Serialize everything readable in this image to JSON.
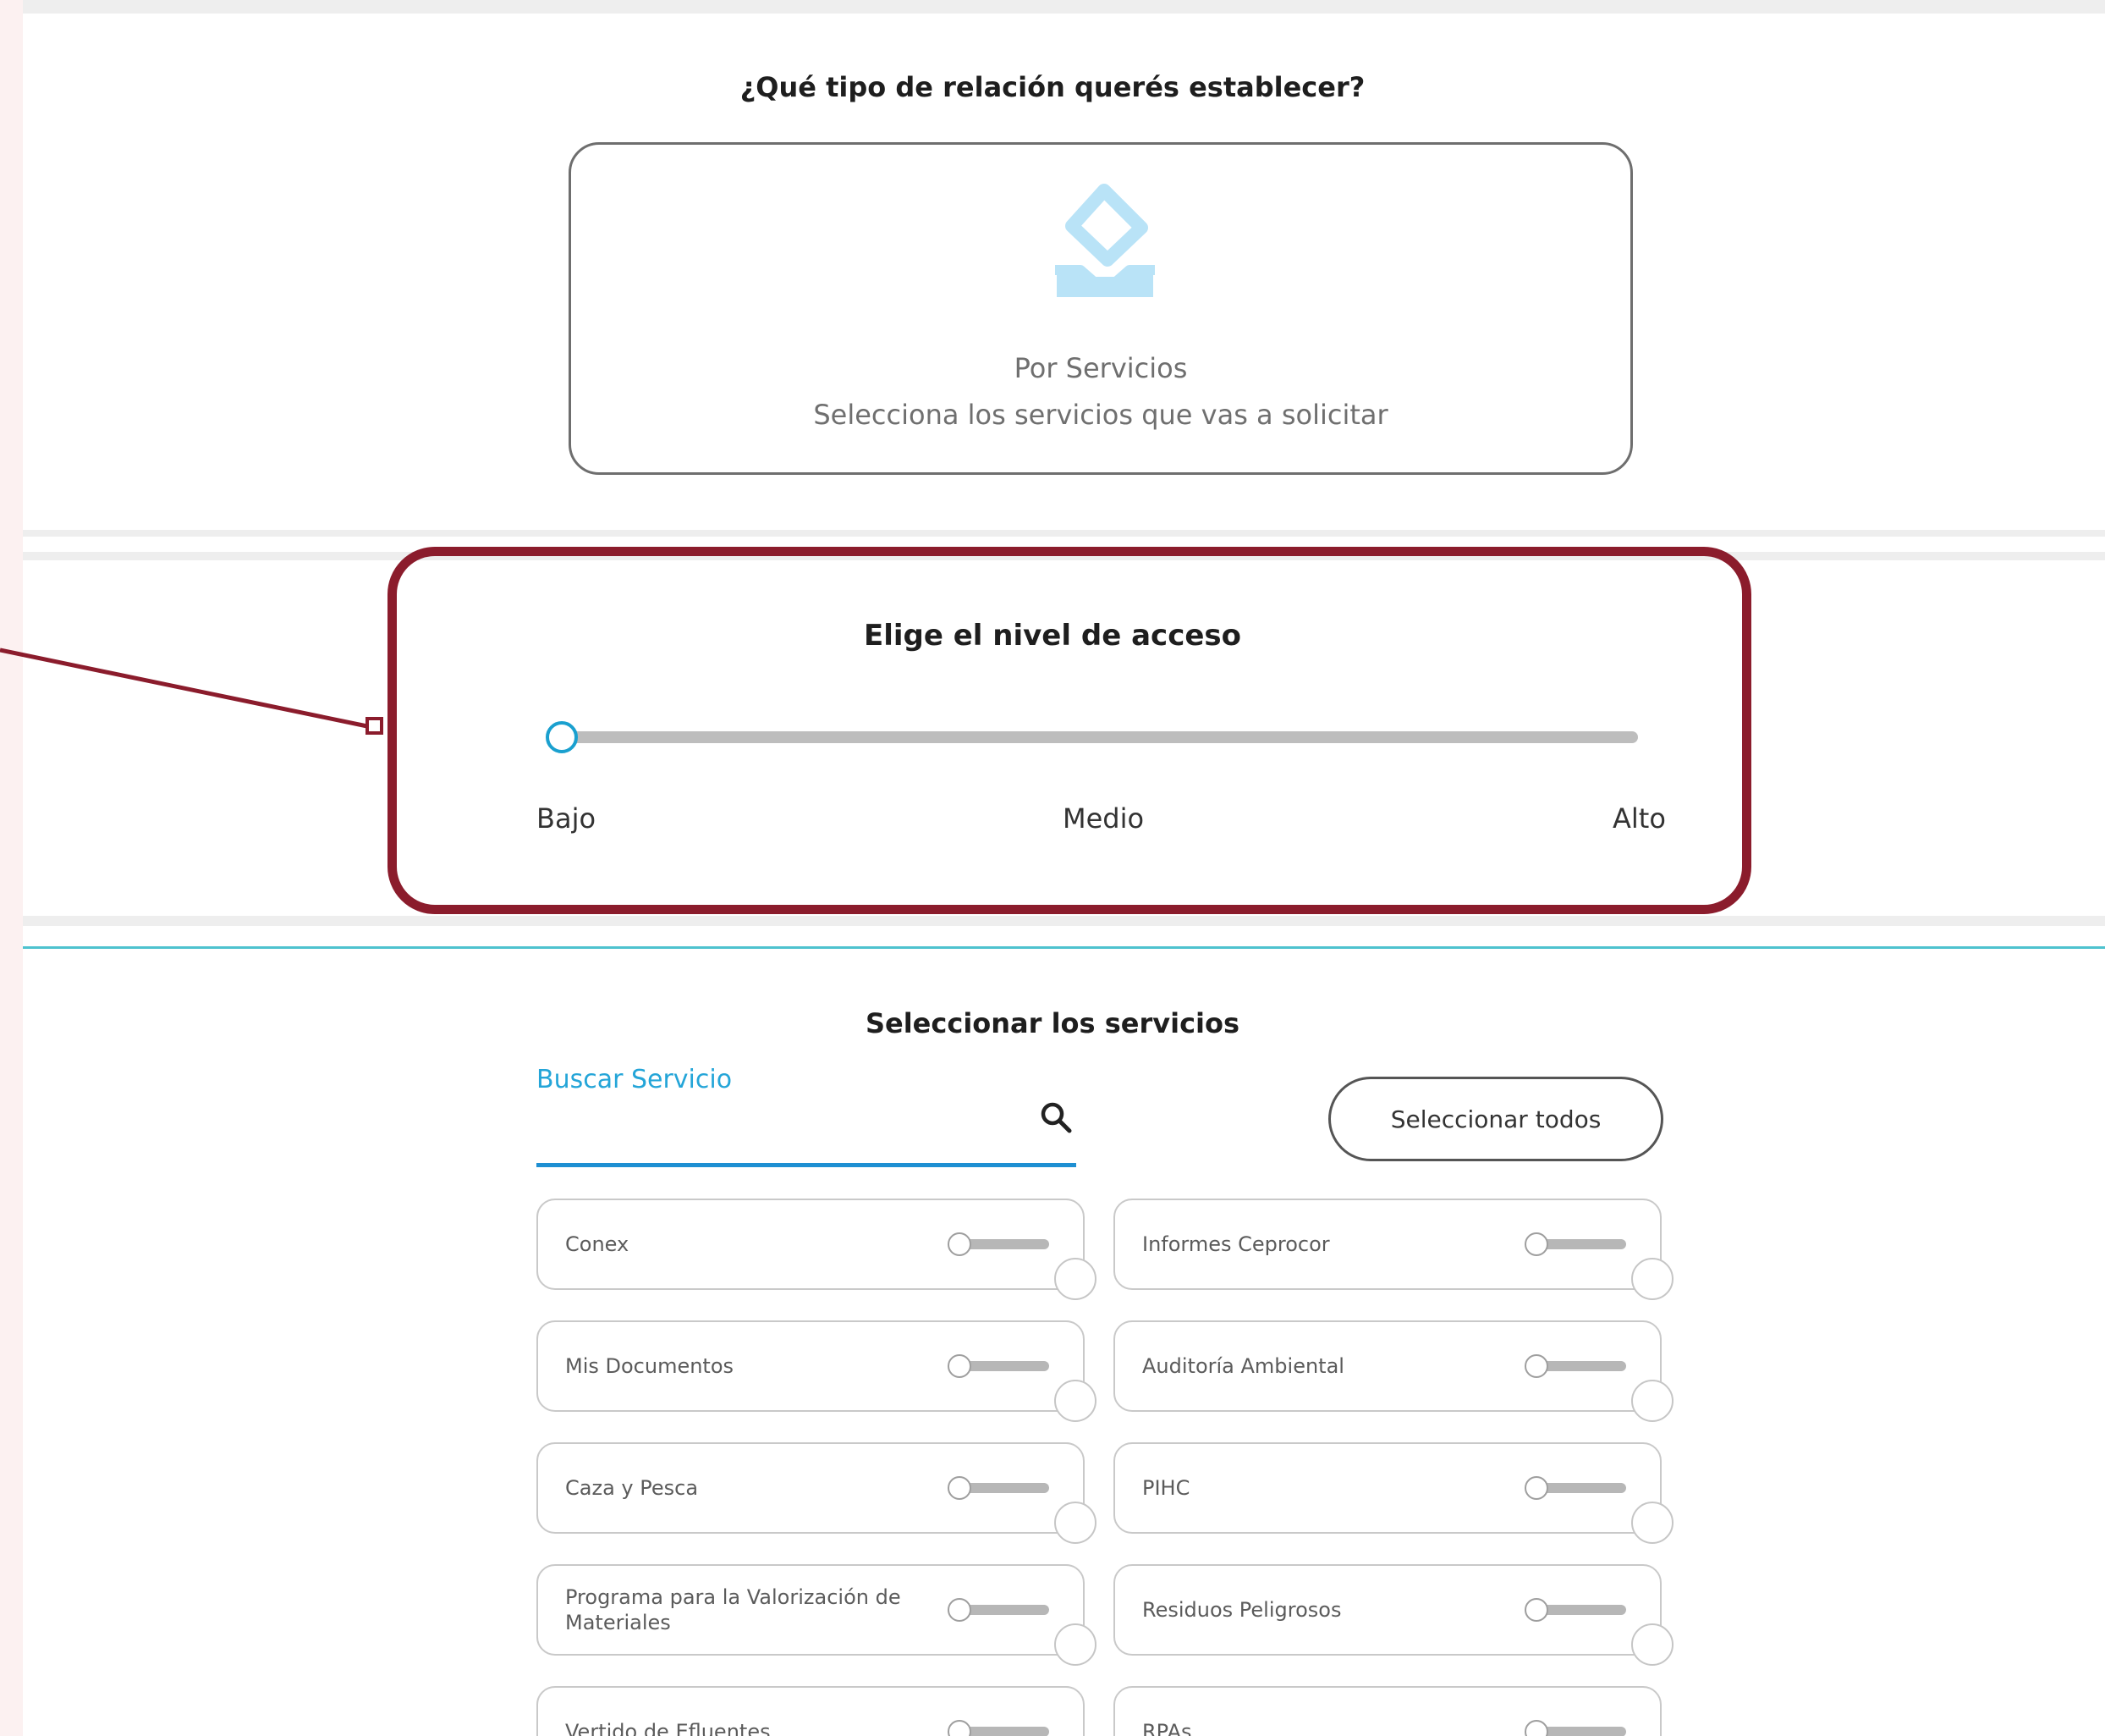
{
  "relation_section": {
    "heading": "¿Qué tipo de relación querés establecer?",
    "card": {
      "icon": "inbox-tray-icon",
      "title": "Por Servicios",
      "description": "Selecciona los servicios que vas a solicitar"
    }
  },
  "access_section": {
    "heading": "Elige el nivel de acceso",
    "slider": {
      "value_label": "Bajo",
      "level_fraction": 0,
      "labels": [
        "Bajo",
        "Medio",
        "Alto"
      ]
    }
  },
  "services_section": {
    "heading": "Seleccionar los servicios",
    "search": {
      "label": "Buscar Servicio",
      "value": "",
      "icon": "search-icon"
    },
    "select_all_label": "Seleccionar todos",
    "items": [
      {
        "name": "Conex",
        "enabled": false
      },
      {
        "name": "Informes Ceprocor",
        "enabled": false
      },
      {
        "name": "Mis Documentos",
        "enabled": false
      },
      {
        "name": "Auditoría Ambiental",
        "enabled": false
      },
      {
        "name": "Caza y Pesca",
        "enabled": false
      },
      {
        "name": "PIHC",
        "enabled": false
      },
      {
        "name": "Programa para la Valorización de Materiales",
        "enabled": false
      },
      {
        "name": "Residuos Peligrosos",
        "enabled": false
      },
      {
        "name": "Vertido de Efluentes",
        "enabled": false
      },
      {
        "name": "RPAs",
        "enabled": false
      }
    ]
  },
  "colors": {
    "highlight": "#8b1c2c",
    "accent": "#24a5d8",
    "icon": "#b9e3f7",
    "slider_thumb": "#1aa0cf"
  }
}
